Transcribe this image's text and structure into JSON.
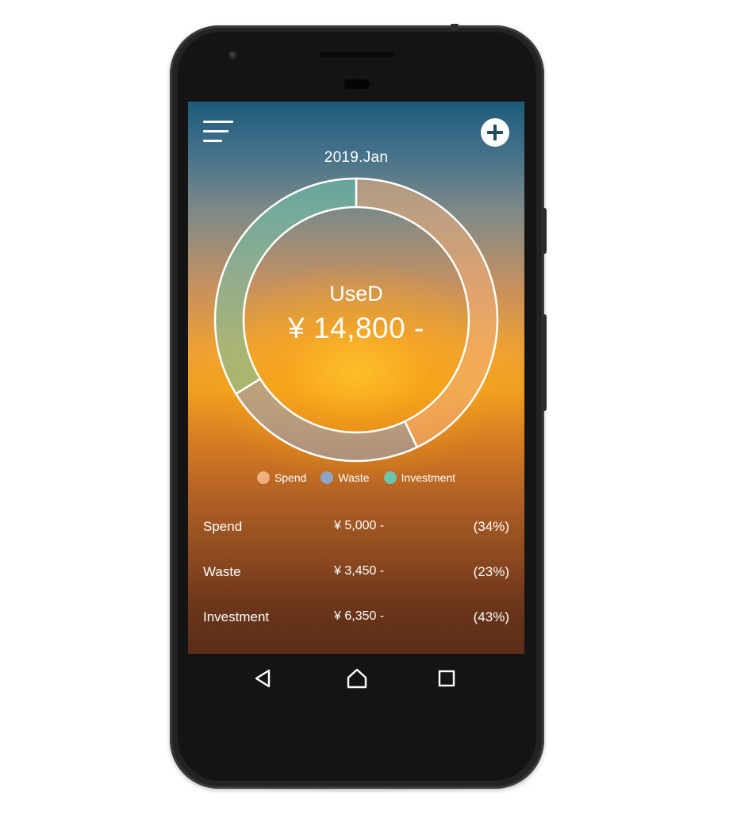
{
  "header": {
    "month": "2019.Jan"
  },
  "summary": {
    "title": "UseD",
    "total": "¥ 14,800 -"
  },
  "chart_data": {
    "type": "pie",
    "categories": [
      "Spend",
      "Waste",
      "Investment"
    ],
    "values": [
      6350,
      3450,
      5000
    ],
    "legend": [
      "Spend",
      "Waste",
      "Investment"
    ],
    "colors": [
      "#f0b07e",
      "#8ea3c8",
      "#6dc4ad"
    ]
  },
  "legend": [
    {
      "label": "Spend",
      "color": "#f0b07e"
    },
    {
      "label": "Waste",
      "color": "#8ea3c8"
    },
    {
      "label": "Investment",
      "color": "#6dc4ad"
    }
  ],
  "breakdown": [
    {
      "name": "Spend",
      "amount": "¥ 5,000 -",
      "percent": "(34%)"
    },
    {
      "name": "Waste",
      "amount": "¥ 3,450 -",
      "percent": "(23%)"
    },
    {
      "name": "Investment",
      "amount": "¥ 6,350 -",
      "percent": "(43%)"
    }
  ],
  "icons": {
    "menu": "hamburger-menu-icon",
    "add": "plus-circle-icon",
    "back": "triangle-back-icon",
    "home": "house-outline-icon",
    "recents": "square-recents-icon"
  }
}
